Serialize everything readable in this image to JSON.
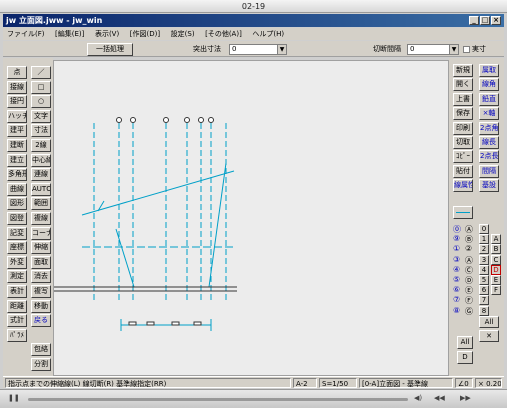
{
  "outer": {
    "title": "02-19"
  },
  "window": {
    "title": "jw 立面図.jww - jw_win",
    "minimize": "_",
    "maximize": "□",
    "close": "×"
  },
  "menu": [
    "ファイル(F)",
    "[編集(E)]",
    "表示(V)",
    "[作図(D)]",
    "設定(S)",
    "[その他(A)]",
    "ヘルプ(H)"
  ],
  "toolbar": {
    "batch_button": "一括処理",
    "protrude_label": "突出寸法",
    "protrude_value": "0",
    "cut_interval_label": "切断間隔",
    "cut_interval_value": "0",
    "actual_label": "実寸"
  },
  "left_tools": [
    [
      "点",
      "／"
    ],
    [
      "接線",
      "□"
    ],
    [
      "接円",
      "○"
    ],
    [
      "ハッチ",
      "文字"
    ],
    [
      "建平",
      "寸法"
    ],
    [
      "建断",
      "2線"
    ],
    [
      "建立",
      "中心線"
    ],
    [
      "多角形",
      "連線"
    ],
    [
      "曲線",
      "AUTO"
    ],
    [
      "図形",
      "範囲"
    ],
    [
      "図登",
      "複線"
    ],
    [
      "記変",
      "コーナー"
    ],
    [
      "座標",
      "伸縮"
    ],
    [
      "外変",
      "面取"
    ],
    [
      "測定",
      "消去"
    ],
    [
      "表計",
      "複写"
    ],
    [
      "距離",
      "移動"
    ],
    [
      "式計",
      "戻る"
    ],
    [
      "ﾊﾟﾗﾒ",
      ""
    ],
    [
      "",
      "包絡"
    ],
    [
      "",
      "分割"
    ]
  ],
  "right_tools": [
    [
      "新規",
      "属取"
    ],
    [
      "開く",
      "線角"
    ],
    [
      "上書",
      "鉛直"
    ],
    [
      "保存",
      "×軸"
    ],
    [
      "印刷",
      "2点角"
    ],
    [
      "切取",
      "線長"
    ],
    [
      "ｺﾋﾟｰ",
      "2点長"
    ],
    [
      "貼付",
      "間隔"
    ],
    [
      "線属性",
      "基設"
    ]
  ],
  "layer_rows": [
    [
      "⓪",
      "Ⓐ",
      "0"
    ],
    [
      "⑨",
      "Ⓑ",
      "1"
    ],
    [
      "①",
      "②",
      "2"
    ],
    [
      "③",
      "Ⓐ",
      "3"
    ],
    [
      "④",
      "Ⓒ",
      "4"
    ],
    [
      "⑤",
      "Ⓓ",
      "5"
    ],
    [
      "⑥",
      "Ⓔ",
      "6"
    ],
    [
      "⑦",
      "Ⓕ",
      "7"
    ],
    [
      "⑧",
      "Ⓖ",
      "8"
    ]
  ],
  "layer_right_extra": [
    "A",
    "B",
    "C",
    "D",
    "E",
    "F"
  ],
  "layer_all": "All",
  "layer_all_x": "✕",
  "layer_all_button": "All",
  "layer_d_button": "D",
  "status": {
    "message": "指示点までの伸縮線(L)  線切断(R)  基準線指定(RR)",
    "paper": "A-2",
    "scale": "S=1/50",
    "layer": "[0-A]立面図 - 基準線",
    "angle": "∠0",
    "zoom": "× 0.20"
  }
}
